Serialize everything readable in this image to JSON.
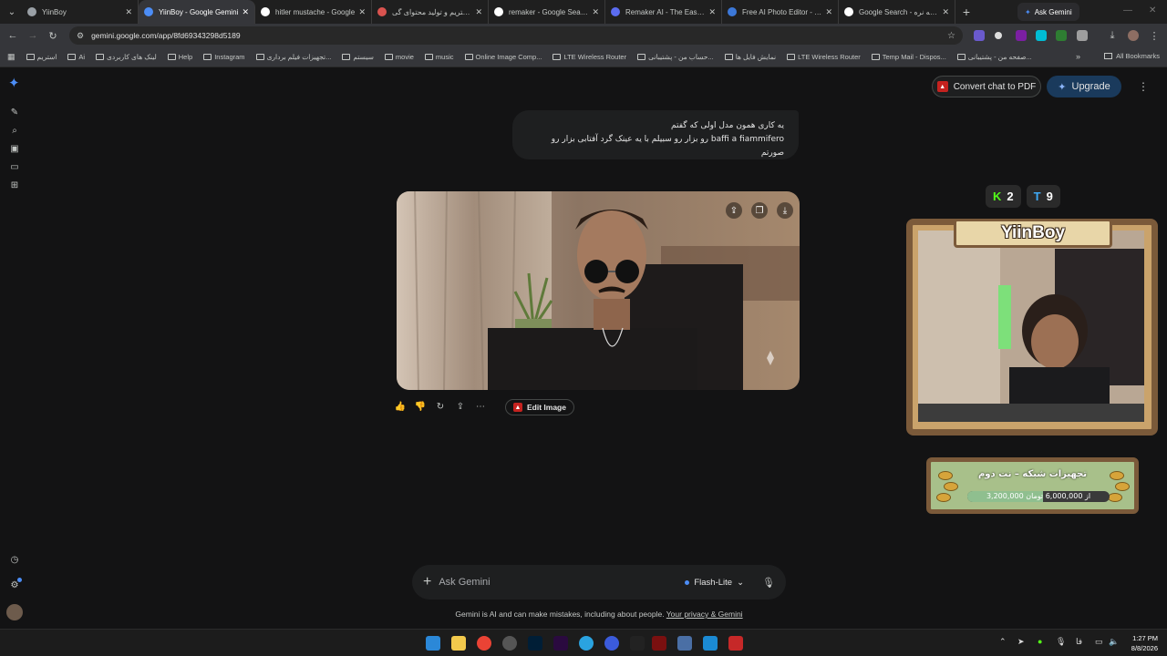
{
  "browser": {
    "tabs": [
      {
        "title": "YiinBoy",
        "color": "#9aa0a6",
        "active": false
      },
      {
        "title": "YiinBoy - Google Gemini",
        "color": "#4c8df6",
        "active": true
      },
      {
        "title": "hitler mustache - Google",
        "color": "#ffffff",
        "active": false
      },
      {
        "title": "استریم و تولید محتوای گی...",
        "color": "#d9534f",
        "active": false
      },
      {
        "title": "remaker - Google Search",
        "color": "#ffffff",
        "active": false
      },
      {
        "title": "Remaker AI - The Easiest",
        "color": "#5b6cf0",
        "active": false
      },
      {
        "title": "Free AI Photo Editor - Ed",
        "color": "#3c78d8",
        "active": false
      },
      {
        "title": "Google Search - گربه نره",
        "color": "#ffffff",
        "active": false
      }
    ],
    "ask_tab": "Ask Gemini",
    "url": "gemini.google.com/app/8fd69343298d5189",
    "bookmarks": [
      "استریم",
      "Ai",
      "لینک های کاربردی",
      "Help",
      "Instagram",
      "تجهیزات فیلم برداری...",
      "سیستم",
      "movie",
      "music",
      "Online Image Comp...",
      "LTE Wireless Router",
      "حساب من - پشتیبانی...",
      "نمایش فایل ها",
      "LTE Wireless Router",
      "Temp Mail - Dispos...",
      "صفحه من - پشتیبانی..."
    ],
    "all_bookmarks": "All Bookmarks"
  },
  "header": {
    "convert_pdf": "Convert chat to PDF",
    "upgrade": "Upgrade"
  },
  "chat": {
    "user_line1": "یه کاری همون مدل اولی که گفتم",
    "user_line2": "baffi a fiammifero رو بزار رو سبیلم با یه عینک گرد آفتابی بزار رو صورتم",
    "edit_image": "Edit Image"
  },
  "input": {
    "placeholder": "Ask Gemini",
    "model": "Flash-Lite"
  },
  "disclaimer": {
    "text": "Gemini is AI and can make mistakes, including about people.",
    "link": "Your privacy & Gemini"
  },
  "stream": {
    "kick_count": "2",
    "t_count": "9",
    "cam_name": "YiinBoy",
    "goal_title": "تجهیزات شبکه – نت دوم",
    "goal_text": "3,200,000 از 6,000,000 تومان",
    "goal_progress": 0.533
  },
  "taskbar": {
    "time": "1:27 PM",
    "date": "8/8/2026",
    "lang": "فا"
  }
}
